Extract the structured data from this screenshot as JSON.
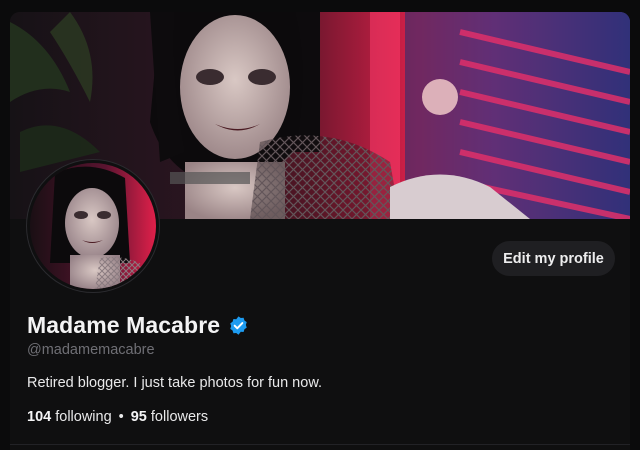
{
  "profile": {
    "display_name": "Madame Macabre",
    "handle": "@madamemacabre",
    "bio": "Retired blogger. I just take photos for fun now.",
    "following_count": "104",
    "following_label": " following",
    "separator": "•",
    "followers_count": "95",
    "followers_label": " followers",
    "verified": true
  },
  "actions": {
    "edit_profile_label": "Edit my profile"
  },
  "icons": {
    "verified": "verified-badge-icon"
  },
  "colors": {
    "background": "#0f0f10",
    "verified_blue": "#1d9bf0",
    "button_bg": "#1f1f22",
    "muted_text": "#6f6f75"
  }
}
